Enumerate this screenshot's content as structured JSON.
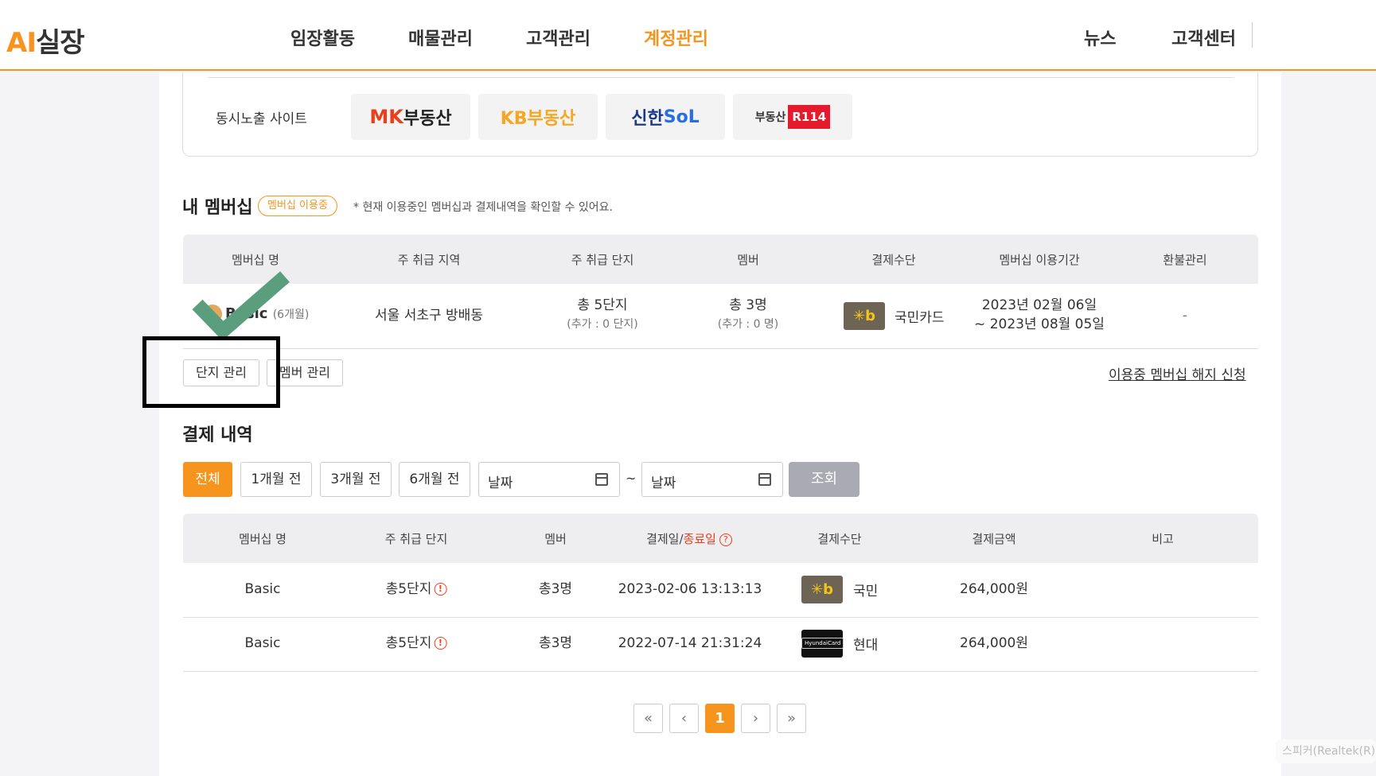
{
  "header": {
    "logo_ai": "AI",
    "logo_text": "실장",
    "nav": [
      "임장활동",
      "매물관리",
      "고객관리",
      "계정관리"
    ],
    "right_nav": [
      "뉴스",
      "고객센터"
    ]
  },
  "sites": {
    "label": "동시노출 사이트",
    "logos": [
      {
        "a": "MK",
        "b": "부동산"
      },
      {
        "a": "KB부동산"
      },
      {
        "a": "신한",
        "b": "SoL"
      },
      {
        "a": "부동산",
        "b": "R114"
      }
    ]
  },
  "membership": {
    "title": "내 멤버십",
    "badge": "멤버십 이용중",
    "note": "* 현재 이용중인 멤버십과 결제내역을 확인할 수 있어요.",
    "headers": [
      "멤버십 명",
      "주 취급 지역",
      "주 취급 단지",
      "멤버",
      "결제수단",
      "멤버십 이용기간",
      "환불관리"
    ],
    "row": {
      "name": "Basic",
      "duration": "(6개월)",
      "region": "서울 서초구 방배동",
      "complex": "총 5단지",
      "complex_extra": "(추가 : 0 단지)",
      "member": "총 3명",
      "member_extra": "(추가 : 0 명)",
      "card_icon": "kb-card-icon",
      "card": "국민카드",
      "period_start": "2023년 02월 06일",
      "period_end": "~ 2023년 08월 05일",
      "refund": "-"
    },
    "buttons": {
      "complex": "단지 관리",
      "member": "멤버 관리"
    },
    "cancel_link": "이용중 멤버십 해지 신청"
  },
  "payments": {
    "title": "결제 내역",
    "filters": [
      "전체",
      "1개월 전",
      "3개월 전",
      "6개월 전"
    ],
    "active_filter": "전체",
    "date_placeholder": "날짜",
    "tilde": "~",
    "search": "조회",
    "headers": {
      "name": "멤버십 명",
      "complex": "주 취급 단지",
      "member": "멤버",
      "date_a": "결제일/",
      "date_b": "종료일",
      "method": "결제수단",
      "amount": "결제금액",
      "note": "비고"
    },
    "rows": [
      {
        "name": "Basic",
        "complex": "총5단지",
        "member": "총3명",
        "date": "2023-02-06 13:13:13",
        "card": "국민",
        "amount": "264,000원"
      },
      {
        "name": "Basic",
        "complex": "총5단지",
        "member": "총3명",
        "date": "2022-07-14 21:31:24",
        "card": "현대",
        "amount": "264,000원"
      }
    ],
    "hyundai_logo_text": "HyundaiCard"
  },
  "pagination": {
    "first": "«",
    "prev": "‹",
    "current": "1",
    "next": "›",
    "last": "»"
  },
  "speaker": "스피커(Realtek(R)",
  "colors": {
    "accent": "#f7941d",
    "check": "#5a9e7d"
  }
}
